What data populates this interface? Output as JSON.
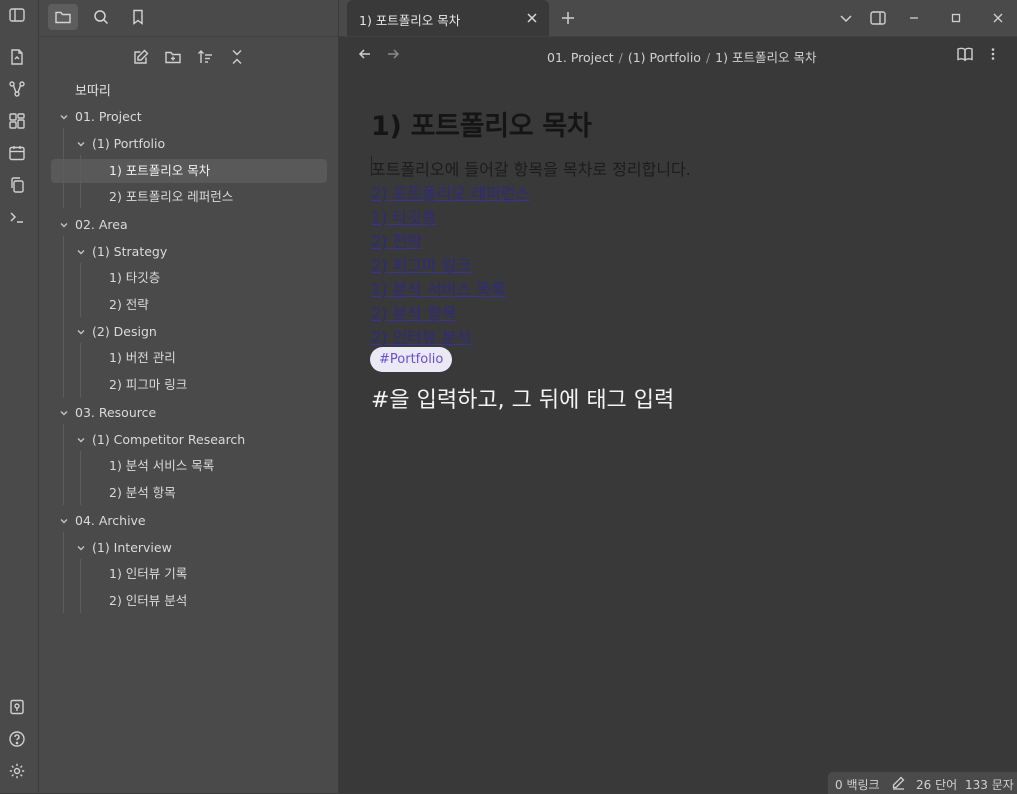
{
  "sidebar": {
    "vault_name": "보따리",
    "tree": [
      {
        "label": "01. Project",
        "depth": 0,
        "expanded": true
      },
      {
        "label": "(1) Portfolio",
        "depth": 1,
        "expanded": true
      },
      {
        "label": "1) 포트폴리오 목차",
        "depth": 2,
        "selected": true
      },
      {
        "label": "2) 포트폴리오 레퍼런스",
        "depth": 2
      },
      {
        "label": "02. Area",
        "depth": 0,
        "expanded": true
      },
      {
        "label": "(1) Strategy",
        "depth": 1,
        "expanded": true
      },
      {
        "label": "1) 타깃층",
        "depth": 2
      },
      {
        "label": "2) 전략",
        "depth": 2
      },
      {
        "label": "(2) Design",
        "depth": 1,
        "expanded": true
      },
      {
        "label": "1) 버전 관리",
        "depth": 2
      },
      {
        "label": "2) 피그마 링크",
        "depth": 2
      },
      {
        "label": "03. Resource",
        "depth": 0,
        "expanded": true
      },
      {
        "label": "(1) Competitor Research",
        "depth": 1,
        "expanded": true
      },
      {
        "label": "1) 분석 서비스 목록",
        "depth": 2
      },
      {
        "label": "2) 분석 항목",
        "depth": 2
      },
      {
        "label": "04. Archive",
        "depth": 0,
        "expanded": true
      },
      {
        "label": "(1) Interview",
        "depth": 1,
        "expanded": true
      },
      {
        "label": "1) 인터뷰 기록",
        "depth": 2
      },
      {
        "label": "2) 인터뷰 분석",
        "depth": 2
      }
    ]
  },
  "tabs": [
    {
      "label": "1) 포트폴리오 목차",
      "active": true
    }
  ],
  "breadcrumb": [
    "01. Project",
    "(1) Portfolio",
    "1) 포트폴리오 목차"
  ],
  "document": {
    "title": "1) 포트폴리오 목차",
    "intro": "포트폴리오에 들어갈 항목을 목차로 정리합니다.",
    "links": [
      "2) 포트폴리오 레퍼런스",
      "1) 타깃층",
      "2) 전략",
      "2) 피그마 링크",
      "1) 분석 서비스 목록",
      "2) 분석 항목",
      "2) 인터뷰 분석"
    ],
    "tag": "#Portfolio",
    "hint": "#을 입력하고, 그 뒤에 태그 입력"
  },
  "status": {
    "backlinks": "0 백링크",
    "words": "26 단어",
    "chars": "133 문자"
  },
  "colors": {
    "accent_tag_text": "#6a4fd0",
    "tag_bg": "#ece9f6",
    "link": "#2f2a7a"
  }
}
